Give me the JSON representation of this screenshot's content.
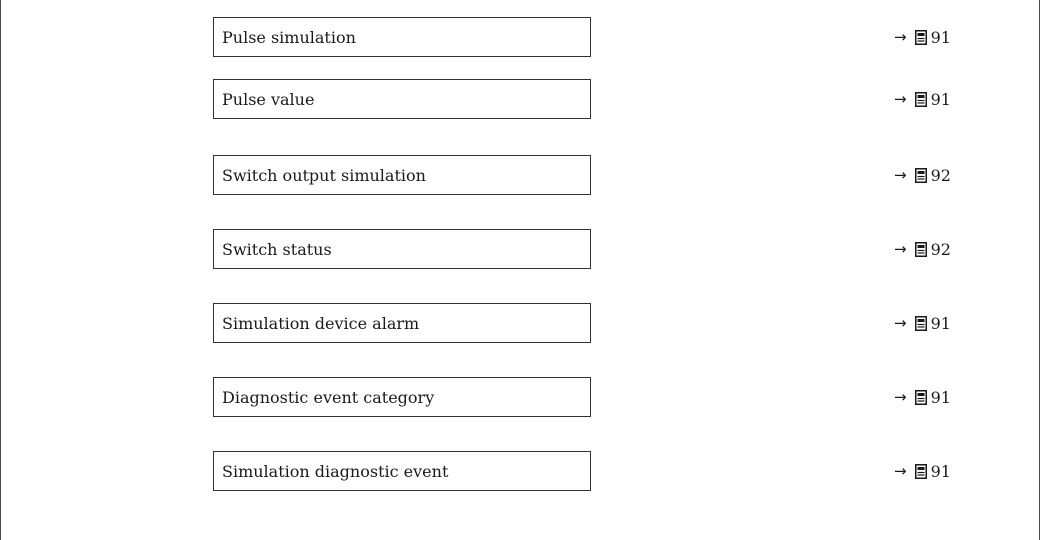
{
  "parameters": [
    {
      "label": "Pulse simulation",
      "arrow": "→",
      "page": "91"
    },
    {
      "label": "Pulse value",
      "arrow": "→",
      "page": "91"
    },
    {
      "label": "Switch output simulation",
      "arrow": "→",
      "page": "92"
    },
    {
      "label": "Switch status",
      "arrow": "→",
      "page": "92"
    },
    {
      "label": "Simulation device alarm",
      "arrow": "→",
      "page": "91"
    },
    {
      "label": "Diagnostic event category",
      "arrow": "→",
      "page": "91"
    },
    {
      "label": "Simulation diagnostic event",
      "arrow": "→",
      "page": "91"
    }
  ],
  "icons": {
    "page_reference": "book-page-icon"
  }
}
